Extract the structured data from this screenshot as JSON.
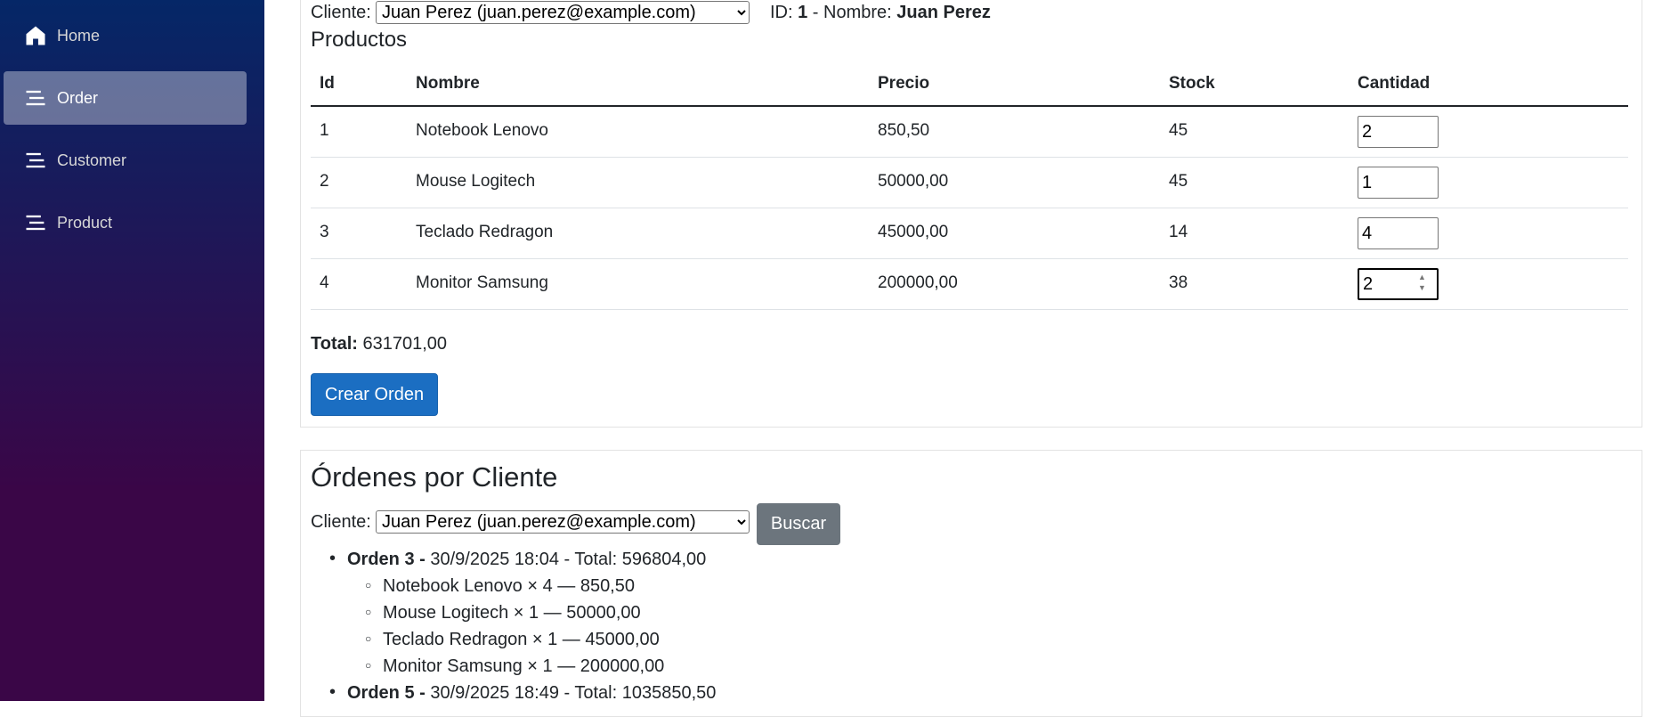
{
  "sidebar": {
    "items": [
      {
        "label": "Home",
        "icon": "home-icon"
      },
      {
        "label": "Order",
        "icon": "list-icon"
      },
      {
        "label": "Customer",
        "icon": "list-icon"
      },
      {
        "label": "Product",
        "icon": "list-icon"
      }
    ],
    "active": "Order"
  },
  "order_form": {
    "client_label": "Cliente:",
    "client_selected": "Juan Perez (juan.perez@example.com)",
    "id_label": "ID:",
    "id_value": "1",
    "name_sep": " - Nombre:",
    "name_value": "Juan Perez",
    "products_heading": "Productos",
    "columns": [
      "Id",
      "Nombre",
      "Precio",
      "Stock",
      "Cantidad"
    ],
    "rows": [
      {
        "id": "1",
        "name": "Notebook Lenovo",
        "price": "850,50",
        "stock": "45",
        "qty": "2"
      },
      {
        "id": "2",
        "name": "Mouse Logitech",
        "price": "50000,00",
        "stock": "45",
        "qty": "1"
      },
      {
        "id": "3",
        "name": "Teclado Redragon",
        "price": "45000,00",
        "stock": "14",
        "qty": "4"
      },
      {
        "id": "4",
        "name": "Monitor Samsung",
        "price": "200000,00",
        "stock": "38",
        "qty": "2"
      }
    ],
    "total_label": "Total:",
    "total_value": "631701,00",
    "create_button": "Crear Orden"
  },
  "orders_by_client": {
    "heading": "Órdenes por Cliente",
    "client_label": "Cliente:",
    "client_selected": "Juan Perez (juan.perez@example.com)",
    "search_button": "Buscar",
    "orders": [
      {
        "title": "Orden 3 -",
        "info": "30/9/2025 18:04 - Total: 596804,00",
        "items": [
          "Notebook Lenovo × 4 — 850,50",
          "Mouse Logitech × 1 — 50000,00",
          "Teclado Redragon × 1 — 45000,00",
          "Monitor Samsung × 1 — 200000,00"
        ]
      },
      {
        "title": "Orden 5 -",
        "info": "30/9/2025 18:49 - Total: 1035850,50",
        "items": []
      }
    ]
  },
  "colors": {
    "sidebar_top": "#052767",
    "sidebar_bottom": "#3a0647",
    "primary": "#1b6ec2",
    "secondary": "#6c757d"
  }
}
